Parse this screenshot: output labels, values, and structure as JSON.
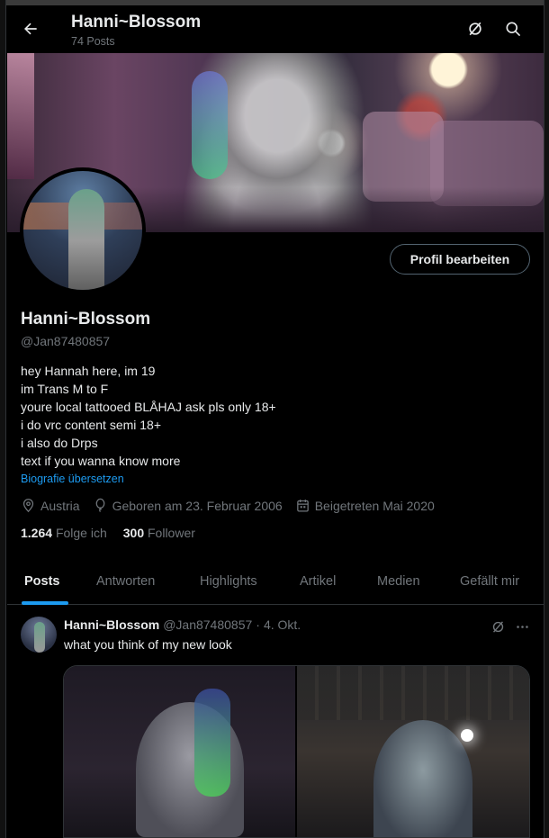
{
  "header": {
    "title": "Hanni~Blossom",
    "post_count": "74 Posts"
  },
  "profile": {
    "edit_button": "Profil bearbeiten",
    "name": "Hanni~Blossom",
    "handle": "@Jan87480857",
    "bio": [
      "hey Hannah here, im 19",
      "im Trans M to F",
      "youre local tattooed BLÅHAJ ask pls only 18+",
      "i do vrc content semi 18+",
      "i also do Drps",
      "text if you wanna know more"
    ],
    "translate_link": "Biografie übersetzen",
    "location": "Austria",
    "birthday": "Geboren am 23. Februar 2006",
    "joined": "Beigetreten Mai 2020",
    "following_count": "1.264",
    "following_label": "Folge ich",
    "followers_count": "300",
    "followers_label": "Follower"
  },
  "tabs": [
    "Posts",
    "Antworten",
    "Highlights",
    "Artikel",
    "Medien",
    "Gefällt mir"
  ],
  "active_tab": "Posts",
  "post": {
    "name": "Hanni~Blossom",
    "handle": "@Jan87480857",
    "separator": "·",
    "date": "4. Okt.",
    "text": "what you think of my new look"
  },
  "colors": {
    "background": "#000000",
    "text_primary": "#e7e9ea",
    "text_secondary": "#71767b",
    "accent": "#1d9bf0",
    "border": "#2f3336"
  },
  "icons": {
    "back": "arrow-left-icon",
    "grok": "grok-icon",
    "search": "search-icon",
    "location": "location-pin-icon",
    "birthday": "balloon-icon",
    "joined": "calendar-icon",
    "more": "more-icon"
  }
}
